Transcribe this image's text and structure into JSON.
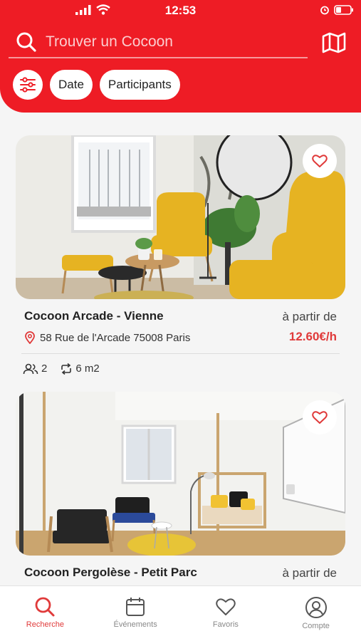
{
  "status": {
    "time": "12:53"
  },
  "search": {
    "placeholder": "Trouver un Cocoon"
  },
  "chips": {
    "date_label": "Date",
    "participants_label": "Participants"
  },
  "listings": [
    {
      "title": "Cocoon Arcade - Vienne",
      "from_label": "à partir de",
      "address": "58 Rue de l'Arcade 75008 Paris",
      "price": "12.60€/h",
      "capacity": "2",
      "area": "6 m2"
    },
    {
      "title": "Cocoon Pergolèse - Petit Parc",
      "from_label": "à partir de"
    }
  ],
  "tabs": [
    {
      "label": "Recherche",
      "icon": "search-icon",
      "active": true
    },
    {
      "label": "Événements",
      "icon": "calendar-icon",
      "active": false
    },
    {
      "label": "Favoris",
      "icon": "heart-icon",
      "active": false
    },
    {
      "label": "Compte",
      "icon": "account-icon",
      "active": false
    }
  ],
  "colors": {
    "brand": "#ee1c25",
    "price": "#e03a3a",
    "photo_accent": "#e6b322"
  }
}
